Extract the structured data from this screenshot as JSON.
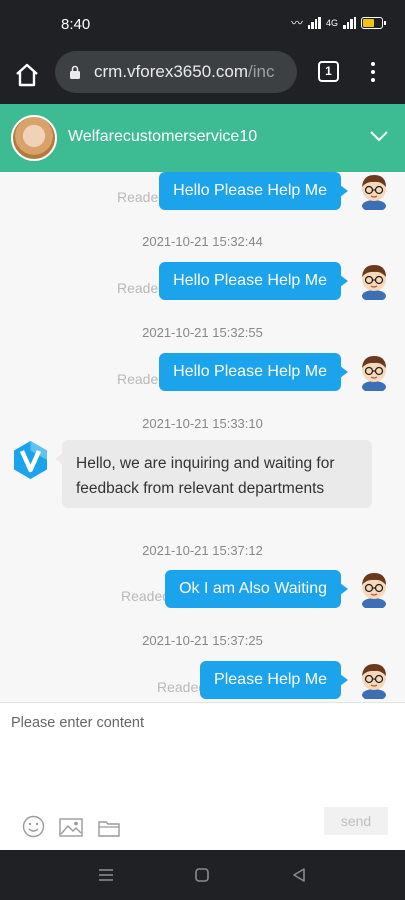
{
  "status_bar": {
    "time": "8:40",
    "network": "4G",
    "battery_level": 0.6,
    "battery_color": "#f1c40f"
  },
  "browser": {
    "url_main": "crm.vforex3650.com",
    "url_tail": "/inc",
    "tab_count": "1"
  },
  "chat_header": {
    "title": "Welfarecustomerservice10",
    "bg_color": "#3dbc94"
  },
  "messages": [
    {
      "kind": "outgoing",
      "text": "Hello Please Help Me",
      "status": "Readed"
    },
    {
      "kind": "timestamp",
      "text": "2021-10-21 15:32:44"
    },
    {
      "kind": "outgoing",
      "text": "Hello Please Help Me",
      "status": "Readed"
    },
    {
      "kind": "timestamp",
      "text": "2021-10-21 15:32:55"
    },
    {
      "kind": "outgoing",
      "text": "Hello Please Help Me",
      "status": "Readed"
    },
    {
      "kind": "timestamp",
      "text": "2021-10-21 15:33:10"
    },
    {
      "kind": "incoming",
      "lines": [
        "Hello, we are inquiring and waiting for",
        "feedback from relevant departments"
      ]
    },
    {
      "kind": "timestamp",
      "text": "2021-10-21 15:37:12"
    },
    {
      "kind": "outgoing",
      "text": "Ok I am Also Waiting",
      "status": "Readed"
    },
    {
      "kind": "timestamp",
      "text": "2021-10-21 15:37:25"
    },
    {
      "kind": "outgoing",
      "text": "Please Help Me",
      "status": "Readed"
    }
  ],
  "composer": {
    "placeholder": "Please enter content",
    "send_label": "send",
    "tools": [
      "emoji-icon",
      "image-icon",
      "folder-icon"
    ]
  },
  "colors": {
    "outgoing_bubble": "#1ba3eb",
    "incoming_bubble": "#eaeaea",
    "brand": "#1ba3eb"
  }
}
